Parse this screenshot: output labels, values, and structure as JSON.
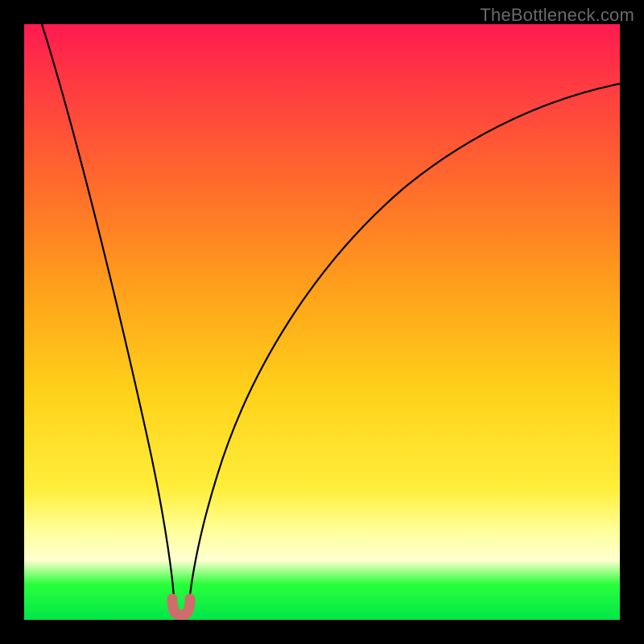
{
  "watermark": {
    "text": "TheBottleneck.com"
  },
  "chart_data": {
    "type": "line",
    "title": "",
    "xlabel": "",
    "ylabel": "",
    "ylim": [
      0,
      100
    ],
    "xlim": [
      0,
      100
    ],
    "series": [
      {
        "name": "left-curve",
        "x": [
          3,
          5,
          8,
          11,
          14,
          17,
          20,
          22,
          23.5,
          24.5,
          25.2
        ],
        "y": [
          100,
          92,
          80,
          67,
          54,
          40,
          24,
          12,
          5,
          2,
          0.5
        ]
      },
      {
        "name": "right-curve",
        "x": [
          27.5,
          28.5,
          30,
          33,
          38,
          45,
          55,
          68,
          82,
          92,
          100
        ],
        "y": [
          0.5,
          3,
          8,
          20,
          37,
          55,
          68,
          78,
          85,
          88,
          90
        ]
      },
      {
        "name": "joint-marker",
        "x": [
          25.2,
          25.5,
          26.0,
          26.5,
          27.0,
          27.5
        ],
        "y": [
          2.0,
          0.7,
          0.4,
          0.4,
          0.7,
          2.0
        ]
      }
    ],
    "gradient_stops": [
      {
        "pos": 0,
        "color": "#ff1a50"
      },
      {
        "pos": 28,
        "color": "#ff6e2a"
      },
      {
        "pos": 62,
        "color": "#ffd21a"
      },
      {
        "pos": 85,
        "color": "#ffff9a"
      },
      {
        "pos": 94,
        "color": "#2aff3a"
      },
      {
        "pos": 100,
        "color": "#00e64a"
      }
    ]
  }
}
